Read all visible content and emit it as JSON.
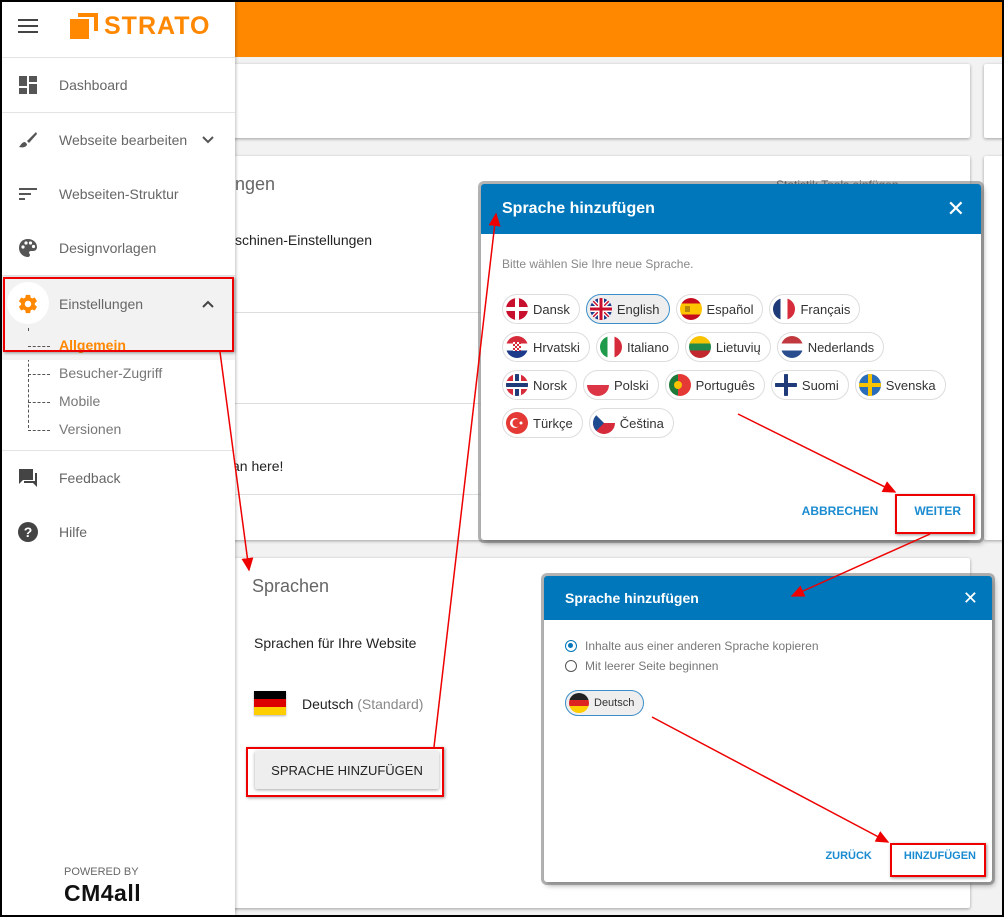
{
  "sidebar": {
    "logo": "STRATO",
    "items": [
      {
        "label": "Dashboard",
        "icon": "dashboard-icon"
      },
      {
        "label": "Webseite bearbeiten",
        "icon": "brush-icon"
      },
      {
        "label": "Webseiten-Struktur",
        "icon": "sort-icon"
      },
      {
        "label": "Designvorlagen",
        "icon": "palette-icon"
      },
      {
        "label": "Einstellungen",
        "icon": "gear-icon"
      },
      {
        "label": "Feedback",
        "icon": "feedback-icon"
      },
      {
        "label": "Hilfe",
        "icon": "help-icon"
      }
    ],
    "subitems": [
      "Allgemein",
      "Besucher-Zugriff",
      "Mobile",
      "Versionen"
    ],
    "powered_by": "POWERED BY",
    "brand": "CM4all",
    "accent": "#ff8800"
  },
  "background": {
    "section_title_partial": "ngen",
    "search_engine_partial": "schinen-Einstellungen",
    "here_partial": "an here!",
    "statistik_partial": "Statistik Tools einfügen",
    "languages_title": "Sprachen",
    "languages_subtitle": "Sprachen für Ihre Website",
    "current_language": "Deutsch",
    "current_language_note": "(Standard)",
    "add_language_button": "SPRACHE HINZUFÜGEN"
  },
  "dialog1": {
    "title": "Sprache hinzufügen",
    "prompt": "Bitte wählen Sie Ihre neue Sprache.",
    "languages": [
      {
        "label": "Dansk",
        "flag": "dk",
        "selected": false
      },
      {
        "label": "English",
        "flag": "gb",
        "selected": true
      },
      {
        "label": "Español",
        "flag": "es",
        "selected": false
      },
      {
        "label": "Français",
        "flag": "fr",
        "selected": false
      },
      {
        "label": "Hrvatski",
        "flag": "hr",
        "selected": false
      },
      {
        "label": "Italiano",
        "flag": "it",
        "selected": false
      },
      {
        "label": "Lietuvių",
        "flag": "lt",
        "selected": false
      },
      {
        "label": "Nederlands",
        "flag": "nl",
        "selected": false
      },
      {
        "label": "Norsk",
        "flag": "no",
        "selected": false
      },
      {
        "label": "Polski",
        "flag": "pl",
        "selected": false
      },
      {
        "label": "Português",
        "flag": "pt",
        "selected": false
      },
      {
        "label": "Suomi",
        "flag": "fi",
        "selected": false
      },
      {
        "label": "Svenska",
        "flag": "se",
        "selected": false
      },
      {
        "label": "Türkçe",
        "flag": "tr",
        "selected": false
      },
      {
        "label": "Čeština",
        "flag": "cz",
        "selected": false
      }
    ],
    "cancel": "ABBRECHEN",
    "next": "WEITER"
  },
  "dialog2": {
    "title": "Sprache hinzufügen",
    "options": [
      {
        "label": "Inhalte aus einer anderen Sprache kopieren",
        "checked": true
      },
      {
        "label": "Mit leerer Seite beginnen",
        "checked": false
      }
    ],
    "source_language": "Deutsch",
    "back": "ZURÜCK",
    "add": "HINZUFÜGEN",
    "header_color": "#0077bb"
  }
}
